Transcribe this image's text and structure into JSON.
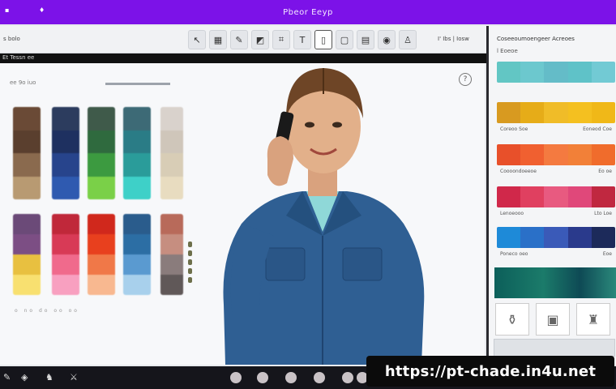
{
  "window": {
    "title": "Pbeor Eeyp"
  },
  "toolbar": {
    "menu_text": "s  bolo",
    "right_text": "I' Ibs  |  Iosw",
    "tools": [
      "cursor-icon",
      "image-icon",
      "brush-icon",
      "camera-icon",
      "crop-icon",
      "text-icon",
      "rectangle-icon",
      "frame-icon",
      "layers-icon",
      "palette-icon",
      "user-icon"
    ]
  },
  "darkbar": {
    "text": "Et  Tessn  ee"
  },
  "canvas": {
    "header_text": "ee   9o  iuo",
    "help_icon": "?",
    "footer_text": "o   no   do   oo   oo"
  },
  "colors": {
    "titlebar": "#7c12e8",
    "accent": "#7c12e8"
  },
  "swatches_row1": [
    [
      "#6a4a36",
      "#5a3f2e",
      "#8a6a4e",
      "#b89a72"
    ],
    [
      "#2c3c5e",
      "#1e3060",
      "#27448c",
      "#2f5ab0"
    ],
    [
      "#3f5a4a",
      "#2f6a3e",
      "#3c9a40",
      "#7ad048"
    ],
    [
      "#3d6a76",
      "#2a7c86",
      "#2a9c9a",
      "#3ed0c8"
    ],
    [
      "#d9d2cc",
      "#cfc6ba",
      "#d8cdb6",
      "#e8dcc0"
    ]
  ],
  "swatches_row2": [
    [
      "#6b4a78",
      "#7c4e84",
      "#e8c040",
      "#f8e070"
    ],
    [
      "#c0283a",
      "#d83a56",
      "#f06a8c",
      "#f8a0c0"
    ],
    [
      "#d0281c",
      "#e8401e",
      "#f07848",
      "#f8b890"
    ],
    [
      "#2a5c8c",
      "#2c6ea4",
      "#5a9ad0",
      "#a8d0ec"
    ],
    [
      "#b86a5a",
      "#c68e80",
      "#8a7c7c",
      "#605858"
    ]
  ],
  "panel": {
    "header": "Coseeoumoengeer Acreoes",
    "subheader": "l Eoeoe",
    "palettes": [
      {
        "colors": [
          "#62c6c4",
          "#6cc8ce",
          "#64bcc8",
          "#5fc2c8",
          "#72cad4"
        ],
        "label_left": "",
        "label_right": ""
      },
      {
        "colors": [
          "#d89a20",
          "#e6ac18",
          "#f0bc28",
          "#f4c020",
          "#f0b818"
        ],
        "label_left": "Coreoo Soe",
        "label_right": "Eoneod Coe"
      },
      {
        "colors": [
          "#e8502a",
          "#f06030",
          "#f47a40",
          "#f28038",
          "#f06c2c"
        ],
        "label_left": "Coooondoeeoe",
        "label_right": "Eo oe"
      },
      {
        "colors": [
          "#d0284a",
          "#e04060",
          "#e85a80",
          "#e0487a",
          "#c02840"
        ],
        "label_left": "Lenoeooo",
        "label_right": "Lto  Loe"
      },
      {
        "colors": [
          "#1e8ad8",
          "#2a70c8",
          "#3a5ab8",
          "#2a3a8c",
          "#1c2a5a"
        ],
        "label_left": "Poneco oeo",
        "label_right": "Eoe"
      }
    ],
    "thumbs": [
      "jar-icon",
      "bag-icon",
      "bottle-icon"
    ]
  },
  "bottombar": {
    "icons": [
      "pen-icon",
      "shapes-icon",
      "figure-icon",
      "knife-icon"
    ],
    "dots": 6
  },
  "watermark": {
    "url": "https://pt-chade.in4u.net"
  }
}
